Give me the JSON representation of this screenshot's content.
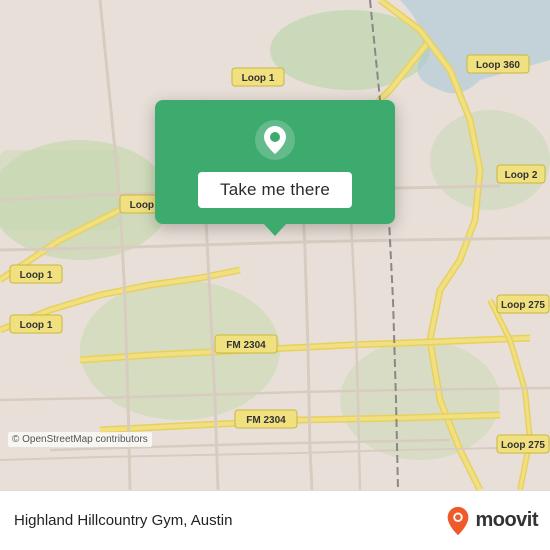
{
  "map": {
    "attribution": "© OpenStreetMap contributors",
    "background_color": "#e8e0d8"
  },
  "popup": {
    "button_label": "Take me there",
    "pin_color": "#ffffff"
  },
  "bottom_bar": {
    "place_name": "Highland Hillcountry Gym, Austin",
    "moovit_label": "moovit"
  },
  "road_labels": [
    "Loop 1",
    "Loop 1",
    "Loop 1",
    "Loop 360",
    "FM 2304",
    "FM 2304",
    "Loop 275",
    "Loop 275",
    "Loop 2"
  ]
}
